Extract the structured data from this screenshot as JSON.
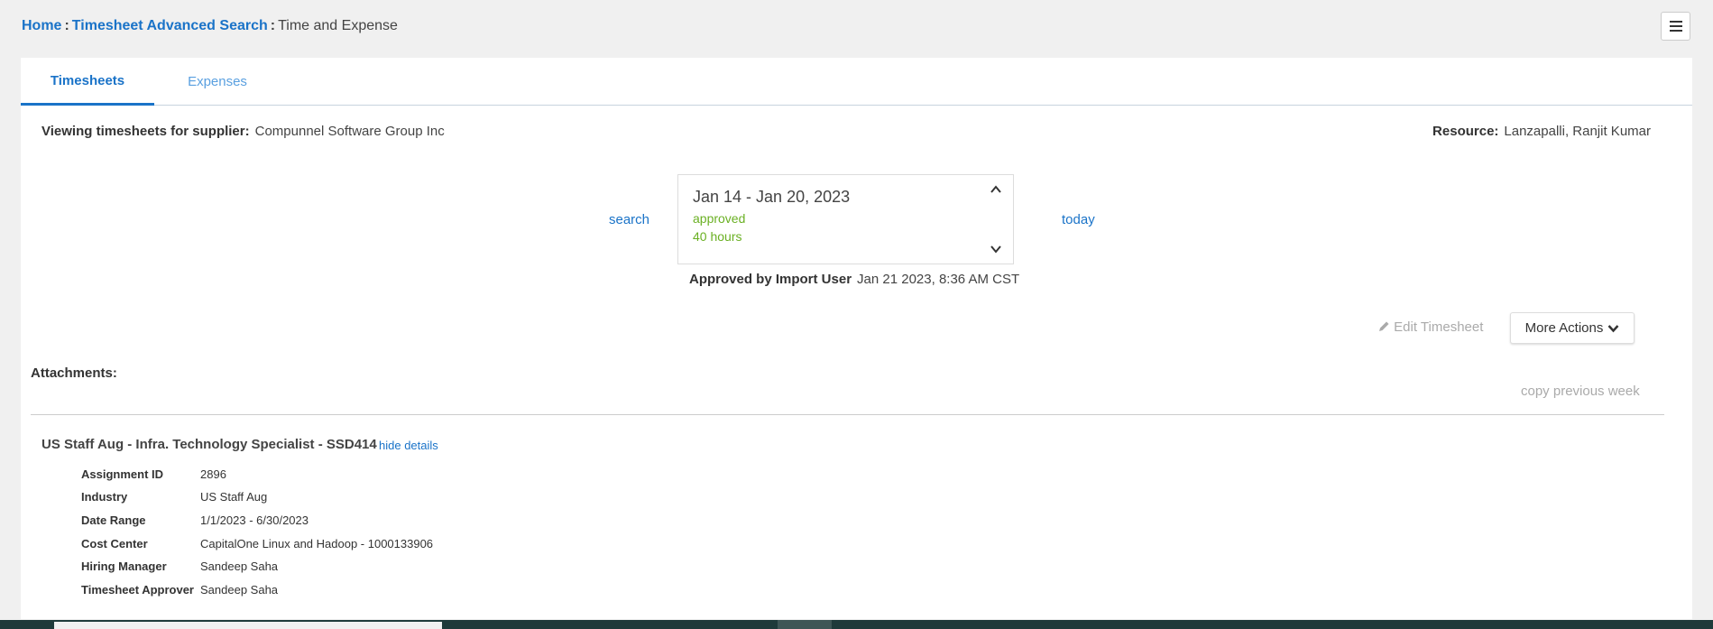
{
  "breadcrumb": {
    "home": "Home",
    "search": "Timesheet Advanced Search",
    "current": "Time and Expense",
    "separator": ":"
  },
  "menu_icon": "hamburger-menu-icon",
  "tabs": [
    {
      "label": "Timesheets",
      "active": true
    },
    {
      "label": "Expenses",
      "active": false
    }
  ],
  "supplier": {
    "label": "Viewing timesheets for supplier:",
    "value": "Compunnel Software Group Inc"
  },
  "resource": {
    "label": "Resource:",
    "value": "Lanzapalli, Ranjit Kumar"
  },
  "nav": {
    "search": "search",
    "today": "today"
  },
  "week": {
    "range": "Jan 14 - Jan 20, 2023",
    "status": "approved",
    "hours": "40 hours"
  },
  "approval": {
    "label": "Approved by Import User",
    "value": "Jan 21 2023, 8:36 AM CST"
  },
  "actions": {
    "edit": "Edit Timesheet",
    "more": "More Actions",
    "copy_previous": "copy previous week"
  },
  "attachments_label": "Attachments:",
  "assignment": {
    "title": "US Staff Aug - Infra. Technology Specialist - SSD414",
    "toggle": "hide details",
    "details": [
      {
        "label": "Assignment ID",
        "value": "2896"
      },
      {
        "label": "Industry",
        "value": "US Staff Aug"
      },
      {
        "label": "Date Range",
        "value": "1/1/2023 - 6/30/2023"
      },
      {
        "label": "Cost Center",
        "value": "CapitalOne Linux and Hadoop - 1000133906"
      },
      {
        "label": "Hiring Manager",
        "value": "Sandeep Saha"
      },
      {
        "label": "Timesheet Approver",
        "value": "Sandeep Saha"
      }
    ]
  },
  "colors": {
    "accent": "#1a73c8",
    "approved": "#6ab023",
    "muted": "#aaaaaa"
  }
}
